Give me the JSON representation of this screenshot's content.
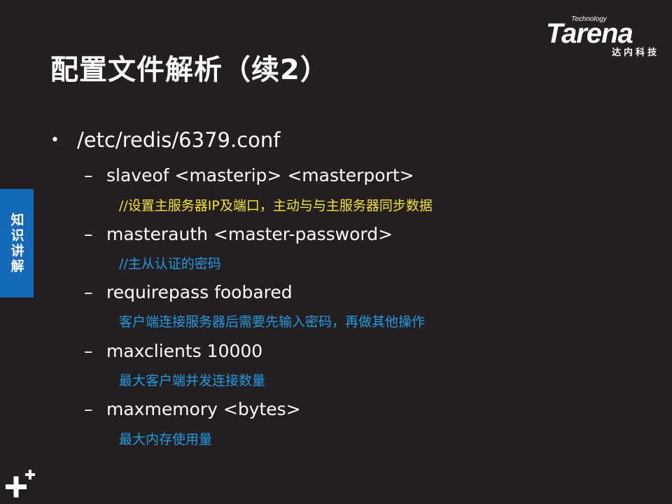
{
  "title": "配置文件解析（续2）",
  "logo": {
    "tech": "Technology",
    "brand": "Tarena",
    "cn": "达内科技"
  },
  "side_tab": "知识讲解",
  "bullet": {
    "text": "/etc/redis/6379.conf"
  },
  "items": [
    {
      "text": "slaveof  <masterip>  <masterport>",
      "note": "//设置主服务器IP及端口，主动与与主服务器同步数据"
    },
    {
      "text": "masterauth  <master-password>",
      "note": "//主从认证的密码"
    },
    {
      "text": "requirepass  foobared",
      "note": "客户端连接服务器后需要先输入密码，再做其他操作"
    },
    {
      "text": "maxclients  10000",
      "note": "最大客户端并发连接数量"
    },
    {
      "text": "maxmemory  <bytes>",
      "note": "最大内存使用量"
    }
  ],
  "colors": {
    "background": "#231f20",
    "side_tab": "#1468b8",
    "note_yellow": "#f5e52a",
    "note_blue": "#1e9be0"
  },
  "icons": {
    "bullet": "•",
    "dash": "–",
    "corner": "plus-icon"
  }
}
